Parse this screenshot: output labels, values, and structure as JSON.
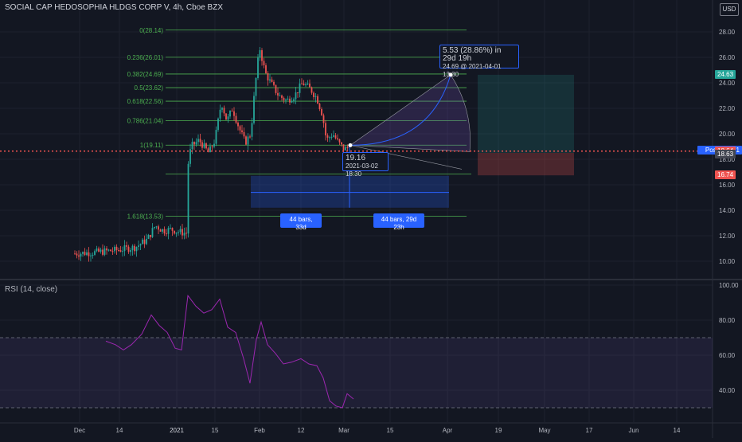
{
  "header": {
    "title": "SOCIAL CAP HEDOSOPHIA HLDGS CORP V, 4h, Cboe BZX",
    "currency_button": "USD",
    "rsi_title": "RSI (14, close)"
  },
  "colors": {
    "background": "#131722",
    "up": "#26a69a",
    "down": "#ef5350",
    "fib": "#4caf50",
    "rsi": "#9c27b0",
    "range": "#2962ff",
    "current_price": "#ef5350"
  },
  "price_axis": {
    "ticks": [
      "28.00",
      "26.00",
      "24.00",
      "22.00",
      "20.00",
      "18.00",
      "16.00",
      "14.00",
      "12.00",
      "10.00"
    ],
    "labels": [
      {
        "text": "24.63",
        "bg": "#26a69a",
        "value": 24.63
      },
      {
        "text": "Post · 18.71",
        "bg": "#2962ff",
        "value": 18.71
      },
      {
        "text": "18.64",
        "bg": "#ef5350",
        "value": 18.64
      },
      {
        "text": "18.63",
        "bg": "#434651",
        "value": 18.4
      },
      {
        "text": "16.74",
        "bg": "#ef5350",
        "value": 16.74
      }
    ]
  },
  "rsi_axis": {
    "ticks": [
      "100.00",
      "80.00",
      "60.00",
      "40.00"
    ]
  },
  "time_axis": {
    "labels": [
      "Dec",
      "14",
      "2021",
      "15",
      "Feb",
      "12",
      "Mar",
      "15",
      "Apr",
      "19",
      "May",
      "17",
      "Jun",
      "14"
    ]
  },
  "fib_levels": [
    {
      "label": "0(28.14)",
      "value": 28.14
    },
    {
      "label": "0.236(26.01)",
      "value": 26.01
    },
    {
      "label": "0.382(24.69)",
      "value": 24.69
    },
    {
      "label": "0.5(23.62)",
      "value": 23.62
    },
    {
      "label": "0.618(22.56)",
      "value": 22.56
    },
    {
      "label": "0.786(21.04)",
      "value": 21.04
    },
    {
      "label": "1(19.11)",
      "value": 19.11
    },
    {
      "label": "1.618(13.53)",
      "value": 13.53
    }
  ],
  "annotations": {
    "projection_main": "5.53 (28.86%) in 29d 19h",
    "projection_sub": "24.69 @ 2021-04-01  13:30",
    "anchor_price": "19.16",
    "anchor_time": "2021-03-02 18:30",
    "bars_left": "44 bars, 33d",
    "bars_right": "44 bars, 29d 23h"
  },
  "chart_data": {
    "type": "candlestick",
    "title": "SOCIAL CAP HEDOSOPHIA HLDGS CORP V, 4h, Cboe BZX",
    "ylim": [
      9.4,
      29.3
    ],
    "current_price": 18.71,
    "price_anchors": [
      {
        "x": 94,
        "p": 10.6
      },
      {
        "x": 120,
        "p": 10.7
      },
      {
        "x": 150,
        "p": 10.9
      },
      {
        "x": 170,
        "p": 11.1
      },
      {
        "x": 185,
        "p": 11.7
      },
      {
        "x": 195,
        "p": 12.8
      },
      {
        "x": 205,
        "p": 12.4
      },
      {
        "x": 215,
        "p": 12.5
      },
      {
        "x": 225,
        "p": 12.3
      },
      {
        "x": 234,
        "p": 12.2
      },
      {
        "x": 236,
        "p": 17.5
      },
      {
        "x": 240,
        "p": 19.0
      },
      {
        "x": 250,
        "p": 19.5
      },
      {
        "x": 262,
        "p": 18.5
      },
      {
        "x": 270,
        "p": 19.5
      },
      {
        "x": 278,
        "p": 22.5
      },
      {
        "x": 285,
        "p": 21.0
      },
      {
        "x": 292,
        "p": 22.0
      },
      {
        "x": 300,
        "p": 20.5
      },
      {
        "x": 308,
        "p": 19.3
      },
      {
        "x": 315,
        "p": 20.0
      },
      {
        "x": 320,
        "p": 23.5
      },
      {
        "x": 326,
        "p": 26.8
      },
      {
        "x": 333,
        "p": 24.8
      },
      {
        "x": 340,
        "p": 24.0
      },
      {
        "x": 350,
        "p": 23.0
      },
      {
        "x": 360,
        "p": 22.6
      },
      {
        "x": 370,
        "p": 23.0
      },
      {
        "x": 380,
        "p": 24.0
      },
      {
        "x": 390,
        "p": 23.5
      },
      {
        "x": 398,
        "p": 22.8
      },
      {
        "x": 405,
        "p": 21.5
      },
      {
        "x": 410,
        "p": 19.5
      },
      {
        "x": 418,
        "p": 20.0
      },
      {
        "x": 425,
        "p": 19.3
      },
      {
        "x": 432,
        "p": 18.8
      },
      {
        "x": 438,
        "p": 18.9
      }
    ],
    "rsi": {
      "ylim": [
        23,
        101
      ],
      "overbought": 70,
      "oversold": 30,
      "anchors": [
        {
          "x": 133,
          "v": 68
        },
        {
          "x": 145,
          "v": 66
        },
        {
          "x": 155,
          "v": 63
        },
        {
          "x": 165,
          "v": 66
        },
        {
          "x": 178,
          "v": 72
        },
        {
          "x": 190,
          "v": 83
        },
        {
          "x": 200,
          "v": 77
        },
        {
          "x": 210,
          "v": 73
        },
        {
          "x": 220,
          "v": 64
        },
        {
          "x": 228,
          "v": 63
        },
        {
          "x": 236,
          "v": 94
        },
        {
          "x": 246,
          "v": 88
        },
        {
          "x": 256,
          "v": 84
        },
        {
          "x": 266,
          "v": 86
        },
        {
          "x": 276,
          "v": 92
        },
        {
          "x": 286,
          "v": 76
        },
        {
          "x": 296,
          "v": 73
        },
        {
          "x": 306,
          "v": 58
        },
        {
          "x": 314,
          "v": 44
        },
        {
          "x": 322,
          "v": 69
        },
        {
          "x": 328,
          "v": 79
        },
        {
          "x": 336,
          "v": 66
        },
        {
          "x": 346,
          "v": 61
        },
        {
          "x": 356,
          "v": 55
        },
        {
          "x": 366,
          "v": 56
        },
        {
          "x": 378,
          "v": 58
        },
        {
          "x": 388,
          "v": 55
        },
        {
          "x": 398,
          "v": 54
        },
        {
          "x": 406,
          "v": 47
        },
        {
          "x": 414,
          "v": 34
        },
        {
          "x": 422,
          "v": 31
        },
        {
          "x": 430,
          "v": 30
        },
        {
          "x": 436,
          "v": 38
        },
        {
          "x": 444,
          "v": 35
        }
      ]
    }
  }
}
